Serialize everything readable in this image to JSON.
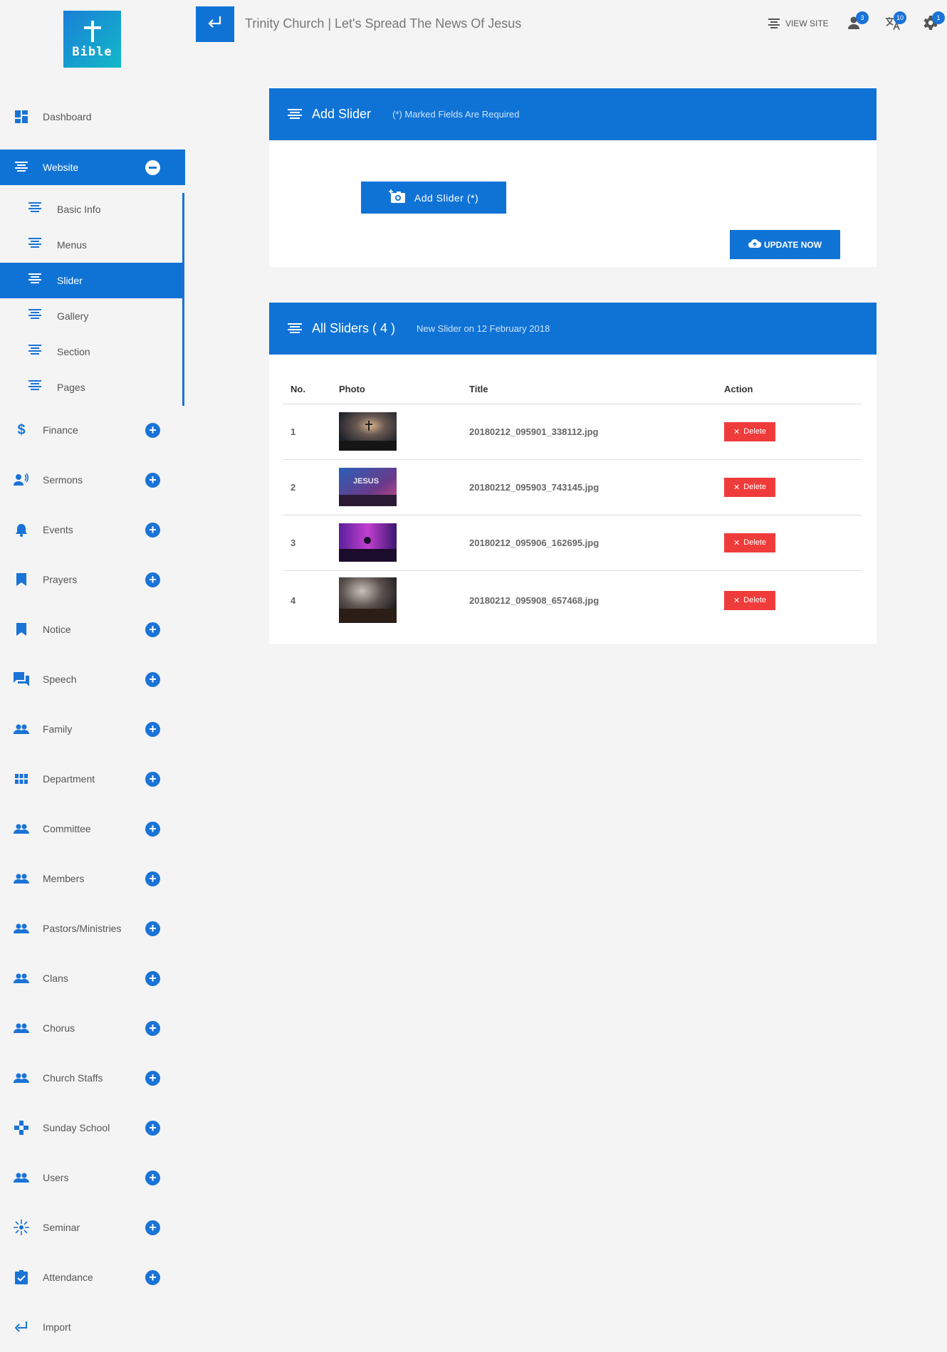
{
  "logo": {
    "text": "Bible"
  },
  "topbar": {
    "title": "Trinity Church | Let's Spread The News Of Jesus",
    "view_site": "VIEW SITE",
    "badges": {
      "users": "3",
      "translate": "10",
      "settings": "1"
    }
  },
  "sidebar": {
    "dashboard": "Dashboard",
    "website": "Website",
    "website_sub": [
      "Basic Info",
      "Menus",
      "Slider",
      "Gallery",
      "Section",
      "Pages"
    ],
    "items": [
      "Finance",
      "Sermons",
      "Events",
      "Prayers",
      "Notice",
      "Speech",
      "Family",
      "Department",
      "Committee",
      "Members",
      "Pastors/Ministries",
      "Clans",
      "Chorus",
      "Church Staffs",
      "Sunday School",
      "Users",
      "Seminar",
      "Attendance"
    ],
    "import": "Import"
  },
  "add_panel": {
    "title": "Add Slider",
    "note": "(*) Marked Fields Are Required",
    "add_button": "Add Slider (*)",
    "update_button": "UPDATE NOW"
  },
  "list_panel": {
    "title": "All Sliders ( 4 )",
    "note": "New Slider on 12 February 2018",
    "columns": [
      "No.",
      "Photo",
      "Title",
      "Action"
    ],
    "rows": [
      {
        "no": "1",
        "title": "20180212_095901_338112.jpg",
        "action": "Delete"
      },
      {
        "no": "2",
        "title": "20180212_095903_743145.jpg",
        "action": "Delete",
        "photo_text": "JESUS"
      },
      {
        "no": "3",
        "title": "20180212_095906_162695.jpg",
        "action": "Delete"
      },
      {
        "no": "4",
        "title": "20180212_095908_657468.jpg",
        "action": "Delete"
      }
    ]
  },
  "colors": {
    "primary": "#0f73d6",
    "danger": "#f03b3b",
    "background": "#f4f4f4"
  }
}
